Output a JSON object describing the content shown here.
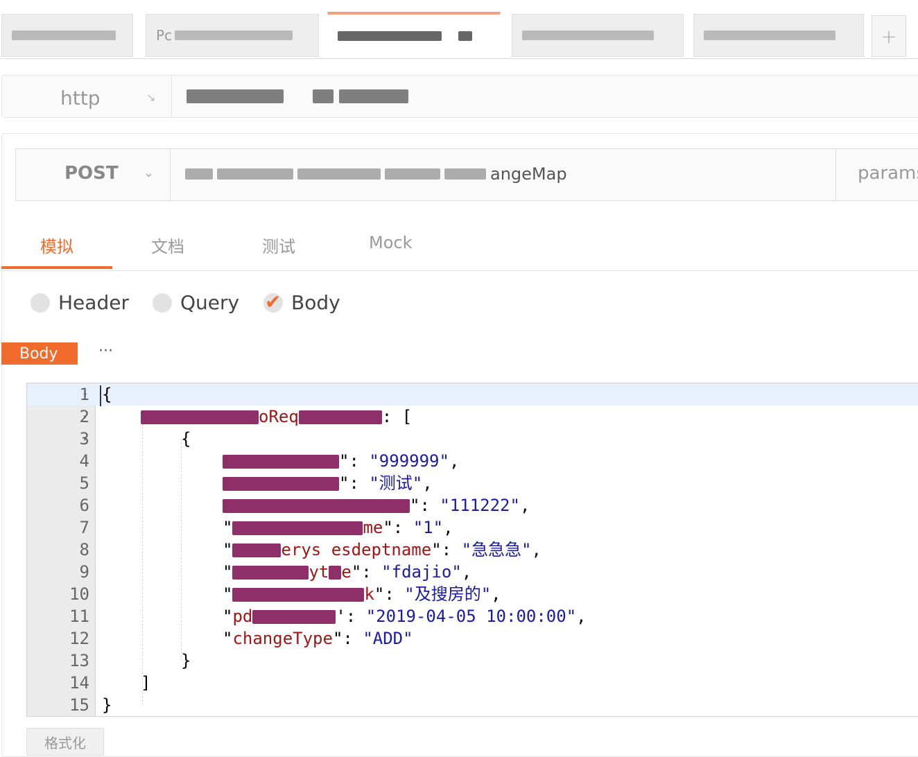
{
  "tabs": [
    {
      "label": "",
      "active": false
    },
    {
      "label": "Pc",
      "active": false
    },
    {
      "label": "",
      "active": true
    },
    {
      "label": "",
      "active": false
    },
    {
      "label": "",
      "active": false
    }
  ],
  "add_tab_label": "+",
  "env": {
    "protocol": "http",
    "host": ""
  },
  "request": {
    "method": "POST",
    "url_suffix": "angeMap",
    "params_label": "params"
  },
  "subtabs": [
    "模拟",
    "文档",
    "测试",
    "Mock"
  ],
  "active_subtab": "模拟",
  "radios": [
    {
      "label": "Header",
      "checked": false
    },
    {
      "label": "Query",
      "checked": false
    },
    {
      "label": "Body",
      "checked": true
    }
  ],
  "body_tag": "Body",
  "body_more": "···",
  "editor": {
    "lines": [
      {
        "n": "1",
        "fold": true
      },
      {
        "n": "2",
        "fold": true
      },
      {
        "n": "3",
        "fold": true
      },
      {
        "n": "4"
      },
      {
        "n": "5"
      },
      {
        "n": "6"
      },
      {
        "n": "7"
      },
      {
        "n": "8"
      },
      {
        "n": "9"
      },
      {
        "n": "10"
      },
      {
        "n": "11"
      },
      {
        "n": "12"
      },
      {
        "n": "13"
      },
      {
        "n": "14"
      },
      {
        "n": "15"
      }
    ],
    "values": {
      "v4": "\"999999\"",
      "v5": "\"测试\"",
      "v6": "\"111222\"",
      "v7": "\"1\"",
      "v8": "\"急急急\"",
      "v9": "\"fdajio\"",
      "v10": "\"及搜房的\"",
      "v11": "\"2019-04-05 10:00:00\"",
      "v12": "\"ADD\""
    },
    "key_fragments": {
      "k2": "oReq",
      "k7": "me",
      "k8": "erys",
      "k8b": "esdeptname",
      "k9": "yt",
      "k9b": "e",
      "k10": "k",
      "k11": "pd",
      "k12": "changeType"
    }
  },
  "format_button": "格式化"
}
